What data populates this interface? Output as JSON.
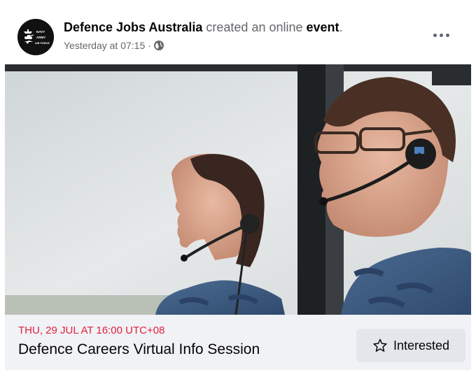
{
  "post": {
    "page_name": "Defence Jobs Australia",
    "action_text": " created an online ",
    "action_object": "event",
    "action_suffix": ".",
    "timestamp": "Yesterday at 07:15",
    "separator": " · ",
    "privacy_icon": "globe-icon",
    "more_icon": "more-options-icon",
    "avatar_lines": [
      "NAVY",
      "ARMY",
      "AIR FORCE"
    ]
  },
  "event": {
    "date_label": "THU, 29 JUL AT 16:00 UTC+08",
    "title": "Defence Careers Virtual Info Session",
    "interested_label": "Interested",
    "interested_icon": "star-icon"
  },
  "colors": {
    "date_red": "#e41e3f",
    "footer_bg": "#f0f2f5",
    "button_bg": "#e4e6eb",
    "secondary_text": "#65676b"
  }
}
